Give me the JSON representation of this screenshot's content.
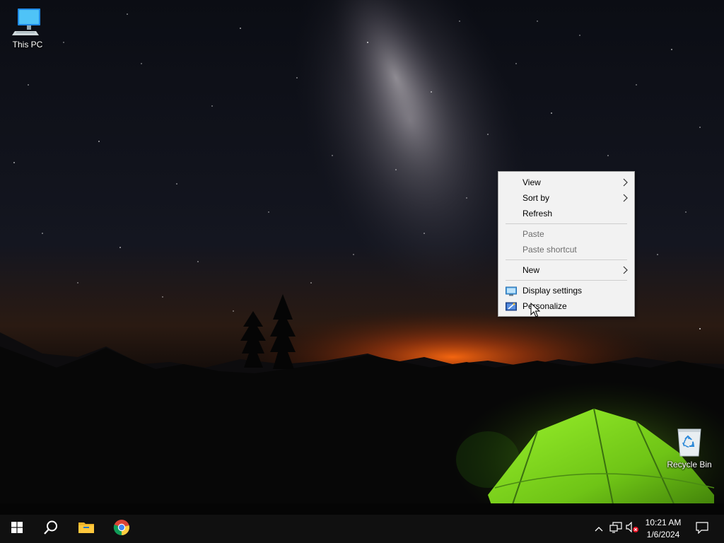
{
  "desktop": {
    "icons": [
      {
        "label": "This PC",
        "icon": "computer-icon"
      },
      {
        "label": "Recycle Bin",
        "icon": "recycle-bin-icon"
      }
    ]
  },
  "context_menu": {
    "items": [
      {
        "label": "View",
        "enabled": true,
        "submenu": true
      },
      {
        "label": "Sort by",
        "enabled": true,
        "submenu": true
      },
      {
        "label": "Refresh",
        "enabled": true,
        "submenu": false
      },
      {
        "label": "Paste",
        "enabled": false,
        "submenu": false
      },
      {
        "label": "Paste shortcut",
        "enabled": false,
        "submenu": false
      },
      {
        "label": "New",
        "enabled": true,
        "submenu": true
      },
      {
        "label": "Display settings",
        "enabled": true,
        "submenu": false,
        "icon": "display-icon"
      },
      {
        "label": "Personalize",
        "enabled": true,
        "submenu": false,
        "icon": "personalize-icon"
      }
    ]
  },
  "taskbar": {
    "pinned": [
      {
        "icon": "windows-start-icon"
      },
      {
        "icon": "search-icon"
      },
      {
        "icon": "file-explorer-icon"
      },
      {
        "icon": "chrome-icon"
      }
    ],
    "tray": {
      "icons": [
        "chevron-up-icon",
        "network-icon",
        "volume-muted-icon"
      ],
      "time": "10:21 AM",
      "date": "1/6/2024"
    }
  },
  "colors": {
    "menu_background": "#f2f2f2",
    "menu_disabled_text": "#6d6d6d",
    "taskbar_background": "#101010",
    "tent_green": "#7ee01a",
    "horizon_glow": "#ff6a10"
  }
}
